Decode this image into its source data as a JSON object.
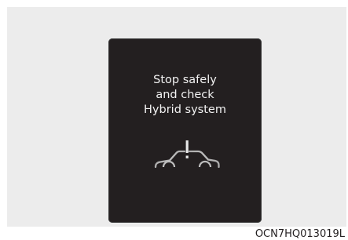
{
  "display": {
    "line1": "Stop safely",
    "line2": "and check",
    "line3": "Hybrid system"
  },
  "icon": "car-warning-icon",
  "image_code": "OCN7HQ013019L",
  "colors": {
    "panel_background": "#ececec",
    "display_background": "#231f20",
    "display_text": "#f2f2f2"
  }
}
